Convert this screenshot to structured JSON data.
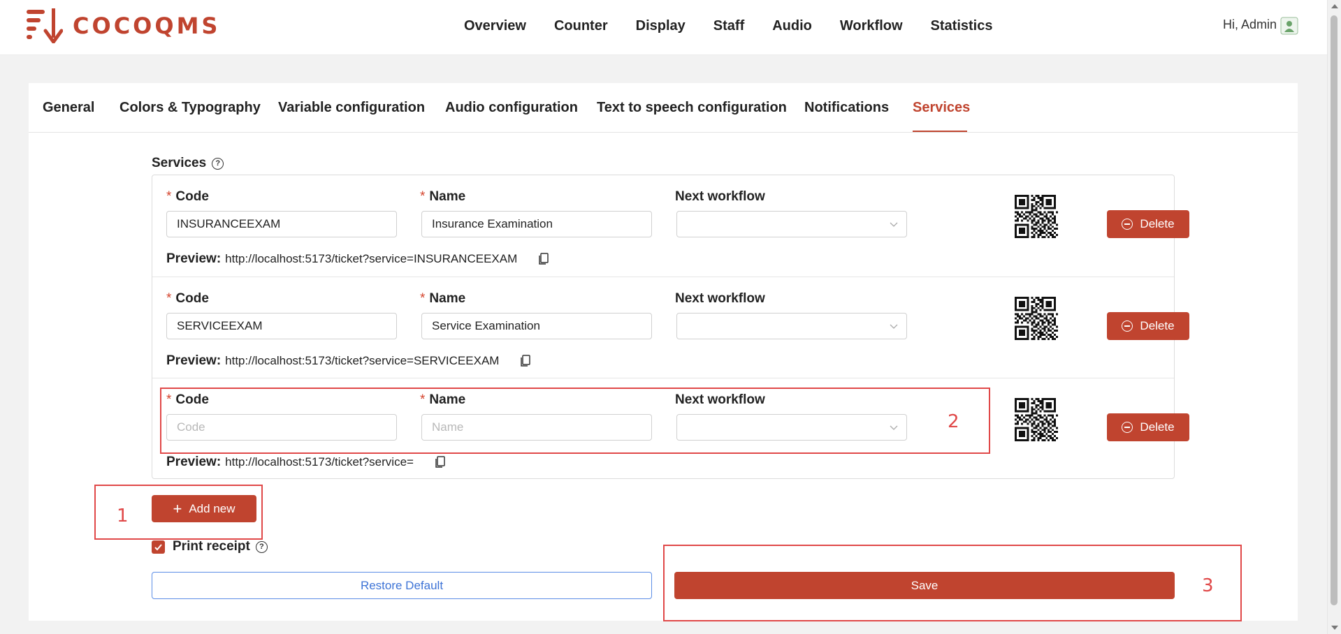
{
  "header": {
    "logo_text": "COCOQMS",
    "nav": [
      "Overview",
      "Counter",
      "Display",
      "Staff",
      "Audio",
      "Workflow",
      "Statistics"
    ],
    "greeting": "Hi, Admin"
  },
  "tabs": [
    "General",
    "Colors & Typography",
    "Variable configuration",
    "Audio configuration",
    "Text to speech configuration",
    "Notifications",
    "Services"
  ],
  "active_tab": "Services",
  "services_section": {
    "title": "Services",
    "code_label": "Code",
    "name_label": "Name",
    "next_workflow_label": "Next workflow",
    "preview_label": "Preview:",
    "delete_label": "Delete",
    "rows": [
      {
        "code": "INSURANCEEXAM",
        "name": "Insurance Examination",
        "next_workflow": "",
        "preview_url": "http://localhost:5173/ticket?service=INSURANCEEXAM"
      },
      {
        "code": "SERVICEEXAM",
        "name": "Service Examination",
        "next_workflow": "",
        "preview_url": "http://localhost:5173/ticket?service=SERVICEEXAM"
      },
      {
        "code": "",
        "name": "",
        "next_workflow": "",
        "preview_url": "http://localhost:5173/ticket?service=",
        "code_placeholder": "Code",
        "name_placeholder": "Name"
      }
    ]
  },
  "add_new_label": "Add new",
  "print_receipt": {
    "label": "Print receipt",
    "checked": true
  },
  "restore_default_label": "Restore Default",
  "save_label": "Save",
  "annotations": [
    "1",
    "2",
    "3"
  ],
  "colors": {
    "accent": "#c0442f",
    "link": "#3d73d6",
    "annotation": "#e04848"
  }
}
